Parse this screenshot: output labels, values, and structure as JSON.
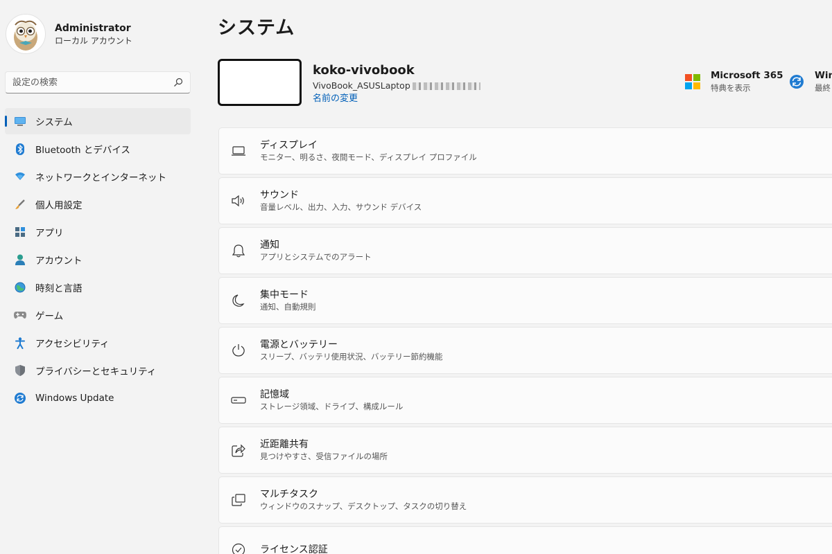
{
  "profile": {
    "name": "Administrator",
    "account_type": "ローカル アカウント"
  },
  "search": {
    "placeholder": "設定の検索"
  },
  "sidebar": {
    "items": [
      {
        "label": "システム",
        "icon": "system-icon",
        "active": true
      },
      {
        "label": "Bluetooth とデバイス",
        "icon": "bluetooth-icon"
      },
      {
        "label": "ネットワークとインターネット",
        "icon": "network-icon"
      },
      {
        "label": "個人用設定",
        "icon": "brush-icon"
      },
      {
        "label": "アプリ",
        "icon": "apps-icon"
      },
      {
        "label": "アカウント",
        "icon": "account-icon"
      },
      {
        "label": "時刻と言語",
        "icon": "time-language-icon"
      },
      {
        "label": "ゲーム",
        "icon": "gamepad-icon"
      },
      {
        "label": "アクセシビリティ",
        "icon": "accessibility-icon"
      },
      {
        "label": "プライバシーとセキュリティ",
        "icon": "shield-icon"
      },
      {
        "label": "Windows Update",
        "icon": "update-icon"
      }
    ]
  },
  "header": {
    "title": "システム"
  },
  "device": {
    "name": "koko-vivobook",
    "model": "VivoBook_ASUSLaptop",
    "rename_label": "名前の変更"
  },
  "promos": {
    "microsoft365": {
      "title": "Microsoft 365",
      "subtitle": "特典を表示"
    },
    "windows_update": {
      "title": "Win",
      "subtitle": "最終"
    }
  },
  "settings": [
    {
      "title": "ディスプレイ",
      "desc": "モニター、明るさ、夜間モード、ディスプレイ プロファイル",
      "icon": "display-icon"
    },
    {
      "title": "サウンド",
      "desc": "音量レベル、出力、入力、サウンド デバイス",
      "icon": "speaker-icon"
    },
    {
      "title": "通知",
      "desc": "アプリとシステムでのアラート",
      "icon": "bell-icon"
    },
    {
      "title": "集中モード",
      "desc": "通知、自動規則",
      "icon": "moon-icon"
    },
    {
      "title": "電源とバッテリー",
      "desc": "スリープ、バッテリ使用状況、バッテリー節約機能",
      "icon": "power-icon"
    },
    {
      "title": "記憶域",
      "desc": "ストレージ領域、ドライブ、構成ルール",
      "icon": "storage-icon"
    },
    {
      "title": "近距離共有",
      "desc": "見つけやすさ、受信ファイルの場所",
      "icon": "share-icon"
    },
    {
      "title": "マルチタスク",
      "desc": "ウィンドウのスナップ、デスクトップ、タスクの切り替え",
      "icon": "multitask-icon"
    },
    {
      "title": "ライセンス認証",
      "desc": "",
      "icon": "check-circle-icon"
    }
  ],
  "colors": {
    "accent": "#005fb8",
    "background": "#f3f3f3",
    "card": "#fbfbfb"
  }
}
